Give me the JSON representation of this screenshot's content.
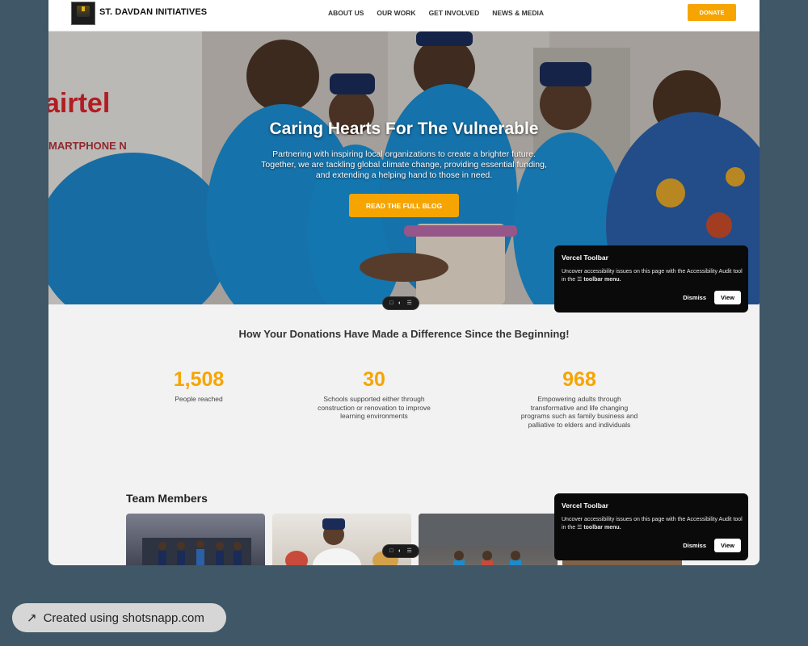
{
  "header": {
    "brand": "ST. DAVDAN INITIATIVES",
    "nav": [
      "ABOUT US",
      "OUR WORK",
      "GET INVOLVED",
      "NEWS & MEDIA"
    ],
    "donate_label": "DONATE"
  },
  "hero": {
    "title": "Caring Hearts For The Vulnerable",
    "subtitle": "Partnering with inspiring local organizations to create a brighter future. Together, we are tackling global climate change, providing essential funding, and extending a helping hand to those in need.",
    "button_label": "READ THE FULL BLOG",
    "photo_signs": [
      "airtel",
      "MARTPHONE N"
    ]
  },
  "vercel_toolbar": {
    "title": "Vercel Toolbar",
    "text_before": "Uncover accessibility issues on this page with the Accessibility Audit tool in the ",
    "menu_icon": "☰",
    "text_bold": "toolbar menu.",
    "dismiss_label": "Dismiss",
    "view_label": "View"
  },
  "impact": {
    "heading": "How Your Donations Have Made a Difference Since the Beginning!",
    "stats": [
      {
        "value": "1,508",
        "label": "People reached"
      },
      {
        "value": "30",
        "label": "Schools supported either through construction or renovation to improve learning environments"
      },
      {
        "value": "968",
        "label": "Empowering adults through transformative and life changing programs such as family business and palliative to elders and individuals"
      }
    ]
  },
  "team": {
    "heading": "Team Members"
  },
  "badge": {
    "icon": "arrow-up-right-icon",
    "label": "Created using shotsnapp.com"
  },
  "colors": {
    "accent": "#f6a500",
    "page_background": "#3f5766",
    "toolbar_popup": "#0a0a0a"
  }
}
